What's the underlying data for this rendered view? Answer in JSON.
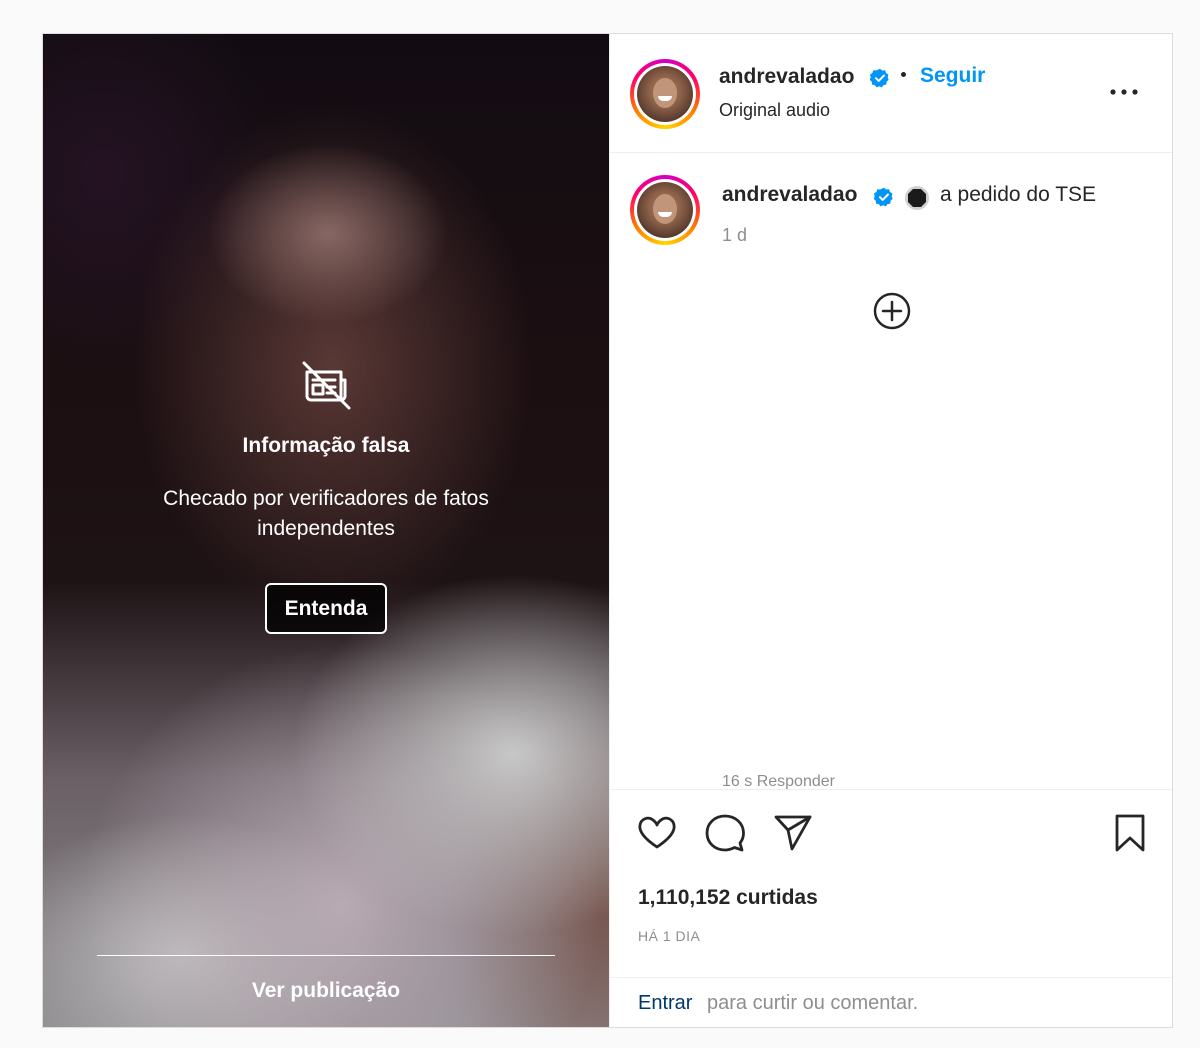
{
  "media": {
    "factcheck_icon": "false-information-icon",
    "title": "Informação falsa",
    "subtitle": "Checado por verificadores de fatos independentes",
    "button_label": "Entenda",
    "view_post_label": "Ver publicação"
  },
  "header": {
    "username": "andrevaladao",
    "verified": true,
    "follow_label": "Seguir",
    "audio_label": "Original audio",
    "more_icon": "more-options-icon"
  },
  "caption": {
    "username": "andrevaladao",
    "emoji": "black-circle-emoji",
    "text": "a pedido do TSE",
    "time": "1 d"
  },
  "comments": {
    "load_more_icon": "plus-circle-icon",
    "partial_text": "16 s    Responder"
  },
  "actions": {
    "like_icon": "heart-icon",
    "comment_icon": "comment-icon",
    "share_icon": "send-icon",
    "save_icon": "bookmark-icon"
  },
  "stats": {
    "likes": "1,110,152 curtidas",
    "date": "HÁ 1 DIA"
  },
  "footer": {
    "login_link": "Entrar",
    "login_text": "para curtir ou comentar."
  },
  "colors": {
    "accent": "#0095f6",
    "verified": "#0095f6",
    "text": "#262626",
    "muted": "#8e8e8e",
    "link": "#00376b"
  }
}
